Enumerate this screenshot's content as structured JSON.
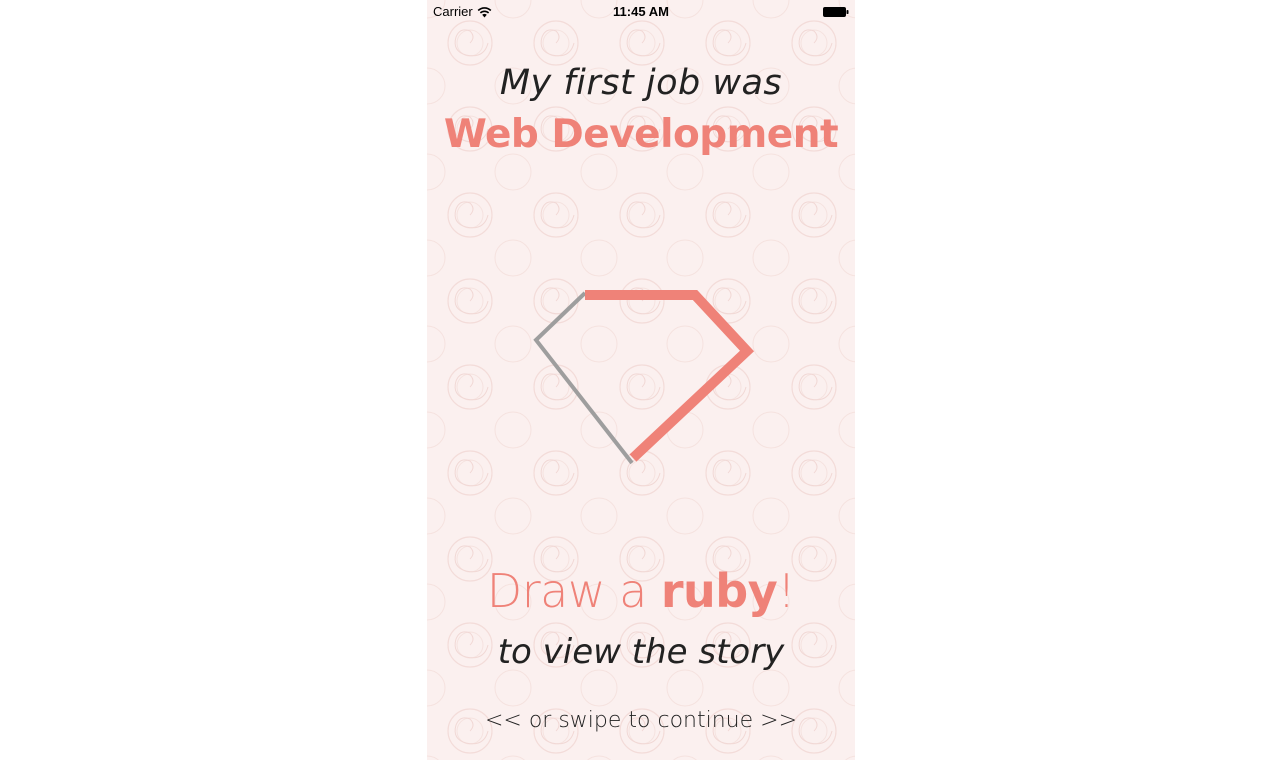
{
  "status_bar": {
    "carrier": "Carrier",
    "time": "11:45 AM"
  },
  "heading": {
    "intro": "My first job was",
    "job": "Web Development"
  },
  "cta": {
    "prefix": "Draw a ",
    "emphasis": "ruby",
    "suffix": "!",
    "subtitle": "to view the story"
  },
  "swipe_hint": "<<  or swipe to continue >>",
  "icons": {
    "wifi": "wifi-icon",
    "battery": "battery-icon"
  },
  "colors": {
    "accent": "#ef8278",
    "pending_stroke": "#9e9e9e",
    "background": "#fbf0ef",
    "text": "#222222"
  }
}
